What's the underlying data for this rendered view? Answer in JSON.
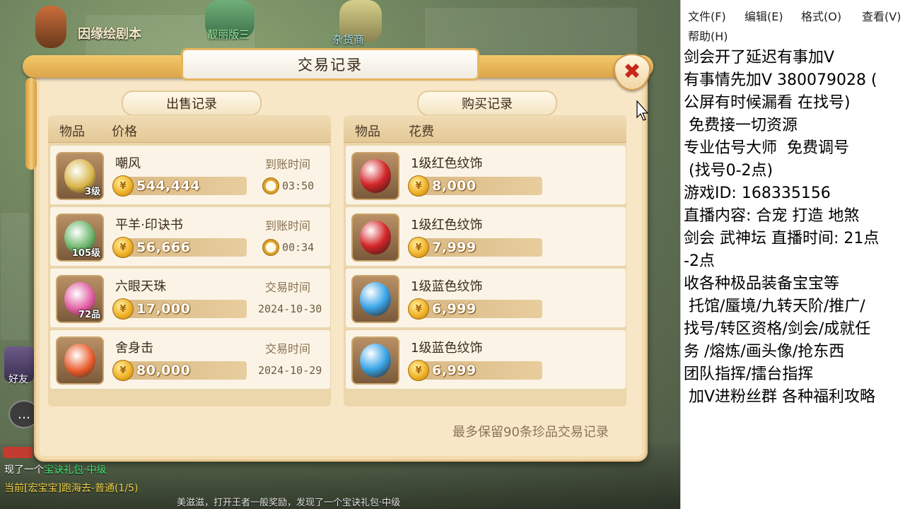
{
  "background": {
    "top_label": "因缘绘剧本",
    "npc_name_2": "靓丽版三",
    "npc_name_3": "杂货商",
    "friend_label": "好友",
    "chat_icon": "speech-bubble-icon",
    "chat": {
      "line1_prefix": "现了一个",
      "line1_item": "宝诀礼包·中级",
      "line2_prefix": "当前",
      "line2_task": "[宏宝宝]跑海去-普通(1/5)",
      "line3": "美滋滋，打开王者一般奖励，发现了一个宝诀礼包·中级"
    }
  },
  "dialog": {
    "title": "交易记录",
    "close_icon": "close-icon",
    "sell_header": "出售记录",
    "buy_header": "购买记录",
    "sell_columns": {
      "item": "物品",
      "price": "价格"
    },
    "buy_columns": {
      "item": "物品",
      "cost": "花费"
    },
    "sell_rows": [
      {
        "name": "嘲风",
        "level": "3级",
        "price": "544,444",
        "time_label": "到账时间",
        "time_value": "03:50",
        "has_clock": true,
        "icon_color": "#d8b64a"
      },
      {
        "name": "平羊·印诀书",
        "level": "105级",
        "price": "56,666",
        "time_label": "到账时间",
        "time_value": "00:34",
        "has_clock": true,
        "icon_color": "#6ab56a"
      },
      {
        "name": "六眼天珠",
        "level": "72品",
        "price": "17,000",
        "time_label": "交易时间",
        "time_value": "2024-10-30",
        "has_clock": false,
        "icon_color": "#e05aa0"
      },
      {
        "name": "舍身击",
        "level": "",
        "price": "80,000",
        "time_label": "交易时间",
        "time_value": "2024-10-29",
        "has_clock": false,
        "icon_color": "#e85a2a"
      }
    ],
    "buy_rows": [
      {
        "name": "1级红色纹饰",
        "price": "8,000",
        "icon_color": "#d4262a"
      },
      {
        "name": "1级红色纹饰",
        "price": "7,999",
        "icon_color": "#d4262a"
      },
      {
        "name": "1级蓝色纹饰",
        "price": "6,999",
        "icon_color": "#3ba5e8"
      },
      {
        "name": "1级蓝色纹饰",
        "price": "6,999",
        "icon_color": "#3ba5e8"
      }
    ],
    "footer_note": "最多保留90条珍品交易记录"
  },
  "notepad": {
    "menu": [
      "文件(F)",
      "编辑(E)",
      "格式(O)",
      "查看(V)",
      "帮助(H)"
    ],
    "lines": [
      "剑会开了延迟有事加V",
      "有事情先加V 380079028 (",
      "公屏有时候漏看 在找号)",
      " 免费接一切资源",
      "专业估号大师  免费调号",
      " (找号0-2点)",
      "游戏ID: 168335156",
      "直播内容: 合宠 打造 地煞",
      "剑会 武神坛 直播时间: 21点",
      "-2点",
      "收各种极品装备宝宝等",
      " 托馆/蜃境/九转天阶/推广/",
      "找号/转区资格/剑会/成就任",
      "务 /熔炼/画头像/抢东西",
      "团队指挥/擂台指挥",
      " 加V进粉丝群 各种福利攻略"
    ]
  }
}
